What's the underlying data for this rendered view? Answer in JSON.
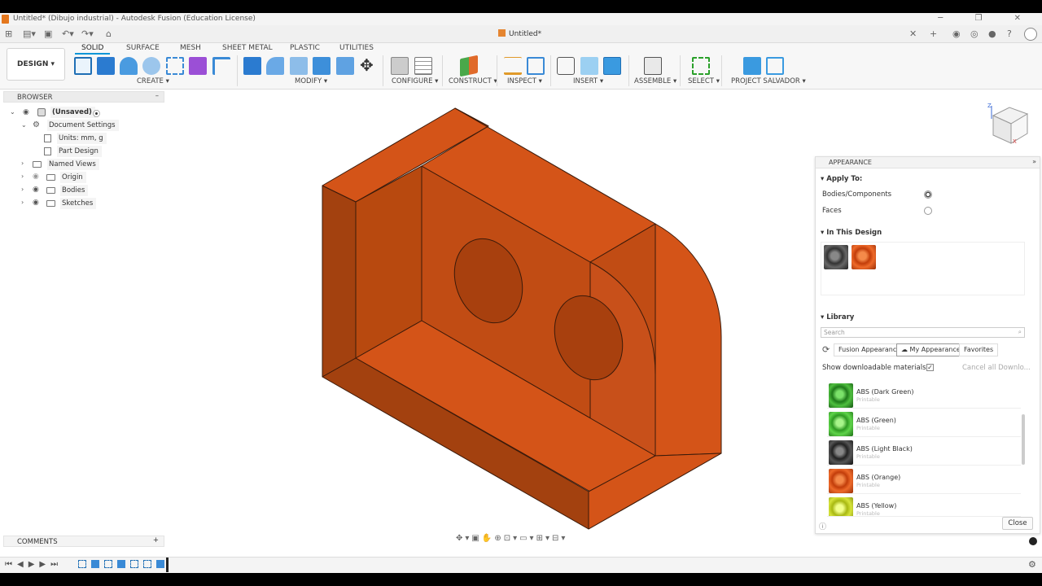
{
  "window": {
    "title": "Untitled* (Dibujo industrial) - Autodesk Fusion (Education License)"
  },
  "document": {
    "tab_title": "Untitled*"
  },
  "ribbon": {
    "workspace": "DESIGN ▾",
    "tabs": [
      "SOLID",
      "SURFACE",
      "MESH",
      "SHEET METAL",
      "PLASTIC",
      "UTILITIES"
    ],
    "groups": [
      "CREATE ▾",
      "MODIFY ▾",
      "CONFIGURE ▾",
      "CONSTRUCT ▾",
      "INSPECT ▾",
      "INSERT ▾",
      "ASSEMBLE ▾",
      "SELECT ▾",
      "PROJECT SALVADOR ▾"
    ]
  },
  "browser": {
    "title": "BROWSER",
    "items": [
      "(Unsaved)",
      "Document Settings",
      "Units: mm, g",
      "Part Design",
      "Named Views",
      "Origin",
      "Bodies",
      "Sketches"
    ]
  },
  "comments": {
    "title": "COMMENTS"
  },
  "appearance": {
    "title": "APPEARANCE",
    "apply_to": "Apply To:",
    "opt_bodies": "Bodies/Components",
    "opt_faces": "Faces",
    "in_design": "In This Design",
    "library": "Library",
    "search_placeholder": "Search",
    "tabs": [
      "Fusion Appearances",
      "My Appearances",
      "Favorites"
    ],
    "show_downloadable": "Show downloadable materials",
    "cancel_downloads": "Cancel all Downlo...",
    "materials": [
      {
        "name": "ABS (Dark Green)",
        "sub": "Printable",
        "color": "#2f8f2a"
      },
      {
        "name": "ABS (Green)",
        "sub": "Printable",
        "color": "#3fb536"
      },
      {
        "name": "ABS (Light Black)",
        "sub": "Printable",
        "color": "#3a3a3a"
      },
      {
        "name": "ABS (Orange)",
        "sub": "Printable",
        "color": "#e05a1e"
      },
      {
        "name": "ABS (Yellow)",
        "sub": "Printable",
        "color": "#c8d62a"
      }
    ],
    "close": "Close"
  },
  "colors": {
    "part": "#d45418",
    "part_dark": "#a3410f",
    "part_mid": "#c14c14",
    "accent": "#0696d7"
  }
}
